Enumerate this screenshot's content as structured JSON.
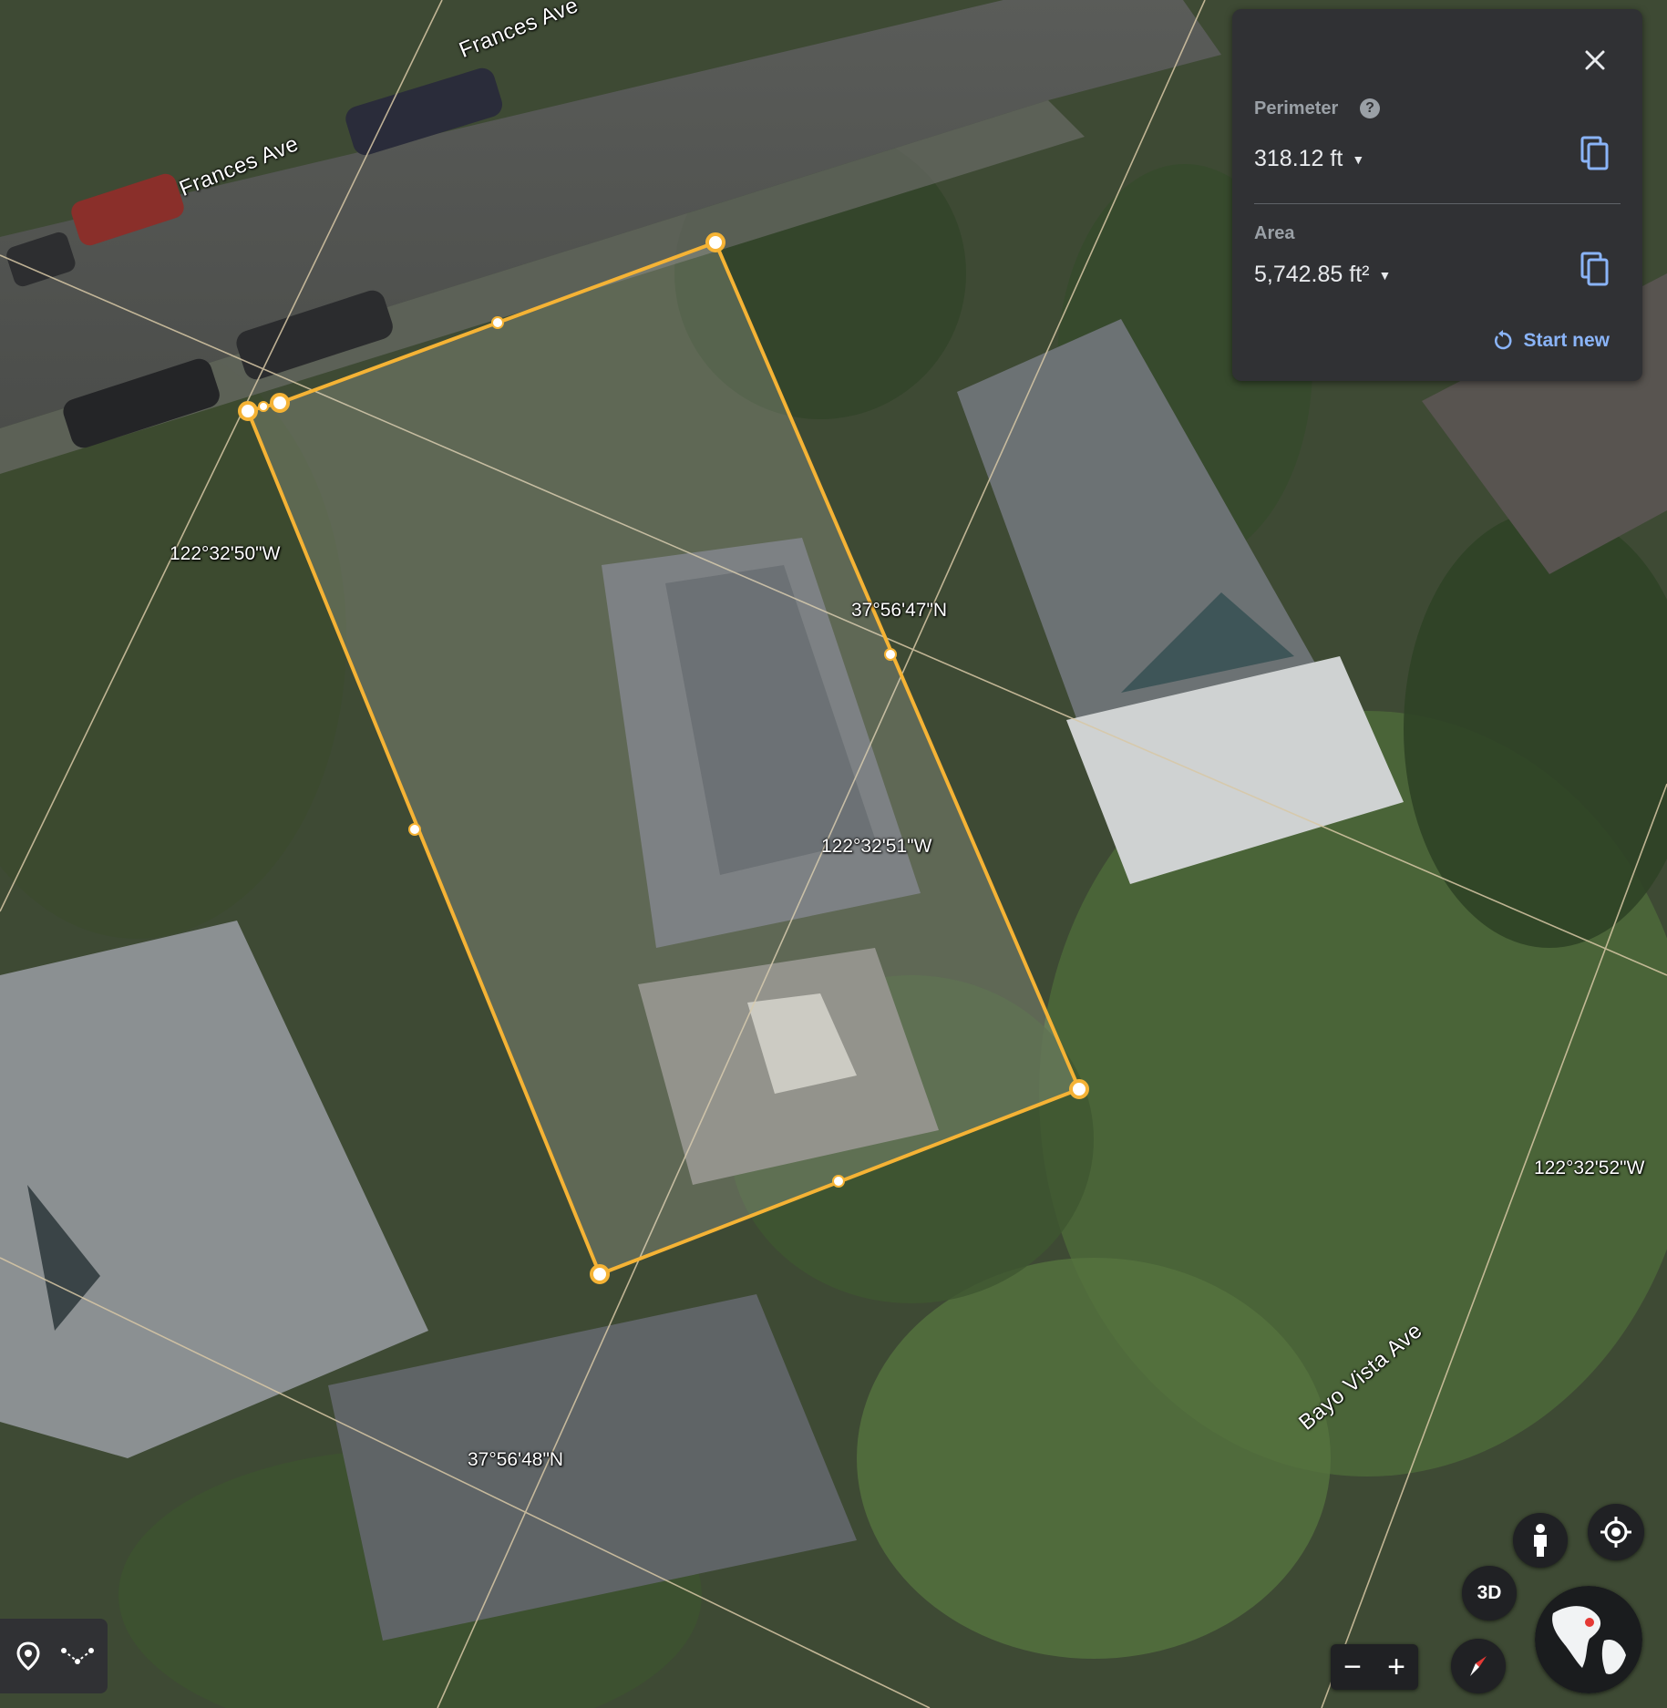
{
  "map": {
    "streets": [
      "Frances Ave",
      "Frances Ave",
      "Bayo Vista Ave"
    ],
    "grid_labels": [
      "122°32'50\"W",
      "37°56'47\"N",
      "122°32'51\"W",
      "122°32'52\"W",
      "37°56'48\"N"
    ]
  },
  "measure_panel": {
    "perimeter_label": "Perimeter",
    "perimeter_value": "318.12 ft",
    "area_label": "Area",
    "area_value": "5,742.85 ft²",
    "start_new": "Start new"
  },
  "controls": {
    "btn_3d": "3D"
  },
  "colors": {
    "measure_line": "#f5b335",
    "panel_bg": "#303134",
    "link_blue": "#8ab4f8"
  },
  "icons": [
    "close-icon",
    "help-icon",
    "copy-icon",
    "refresh-icon",
    "place-icon",
    "path-icon",
    "pegman-icon",
    "locate-icon",
    "compass-icon",
    "globe-icon"
  ]
}
